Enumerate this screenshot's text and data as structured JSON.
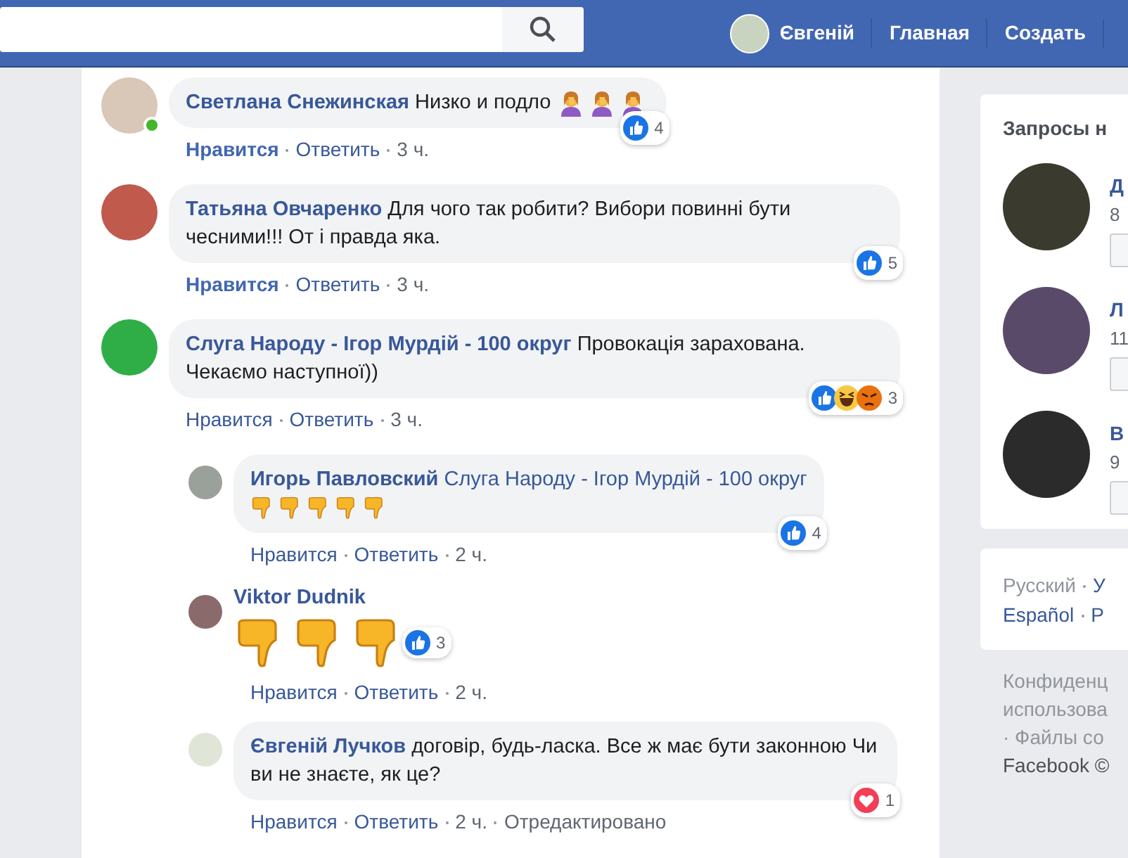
{
  "topbar": {
    "user": "Євгеній",
    "links": [
      "Главная",
      "Создать"
    ]
  },
  "comments": [
    {
      "kind": "text",
      "author": "Светлана Снежинская",
      "text": "Низко и подло",
      "emojis": [
        {
          "kind": "facepalm"
        },
        {
          "kind": "facepalm"
        },
        {
          "kind": "facepalm"
        }
      ],
      "online": true,
      "like": "Нравится",
      "liked": true,
      "reply": "Ответить",
      "time": "3 ч.",
      "reactions": [
        {
          "kind": "like"
        }
      ],
      "reaction_count": "4"
    },
    {
      "kind": "text",
      "author": "Татьяна Овчаренко",
      "text": "Для чого так робити? Вибори повинні бути чесними!!! От і правда яка.",
      "online": false,
      "like": "Нравится",
      "liked": true,
      "reply": "Ответить",
      "time": "3 ч.",
      "reactions": [
        {
          "kind": "like"
        }
      ],
      "reaction_count": "5"
    },
    {
      "kind": "text",
      "author": "Слуга Народу - Ігор Мурдій - 100 округ",
      "text": "Провокація зарахована. Чекаємо наступної))",
      "online": false,
      "like": "Нравится",
      "liked": false,
      "reply": "Ответить",
      "time": "3 ч.",
      "reactions": [
        {
          "kind": "like"
        },
        {
          "kind": "haha"
        },
        {
          "kind": "angry"
        }
      ],
      "reaction_count": "3",
      "replies": [
        {
          "kind": "text",
          "author": "Игорь Павловский",
          "mention": "Слуга Народу - Ігор Мурдій - 100 округ",
          "emojis": [
            {
              "kind": "thumbs_down"
            },
            {
              "kind": "thumbs_down"
            },
            {
              "kind": "thumbs_down"
            },
            {
              "kind": "thumbs_down"
            },
            {
              "kind": "thumbs_down"
            }
          ],
          "like": "Нравится",
          "liked": false,
          "reply": "Ответить",
          "time": "2 ч.",
          "reactions": [
            {
              "kind": "like"
            }
          ],
          "reaction_count": "4"
        },
        {
          "kind": "emoji",
          "author": "Viktor Dudnik",
          "emojis": [
            {
              "kind": "thumbs_down"
            },
            {
              "kind": "thumbs_down"
            },
            {
              "kind": "thumbs_down"
            }
          ],
          "like": "Нравится",
          "liked": false,
          "reply": "Ответить",
          "time": "2 ч.",
          "reactions": [
            {
              "kind": "like"
            }
          ],
          "reaction_count": "3"
        },
        {
          "kind": "text",
          "author": "Євгеній Лучков",
          "text": "договір, будь-ласка. Все ж має бути законною Чи ви не знаєте, як це?",
          "like": "Нравится",
          "liked": false,
          "reply": "Ответить",
          "time": "2 ч.",
          "edited": "Отредактировано",
          "reactions": [
            {
              "kind": "love"
            }
          ],
          "reaction_count": "1"
        }
      ]
    }
  ],
  "sidebar": {
    "requests": {
      "title": "Запросы н",
      "people": [
        {
          "name": "Д",
          "info": "8"
        },
        {
          "name": "Л",
          "info": "11"
        },
        {
          "name": "В",
          "info": "9"
        }
      ]
    },
    "languages": [
      {
        "label": "Русский",
        "selected": true
      },
      {
        "label": "У",
        "selected": false
      },
      {
        "label": "Español",
        "selected": false
      },
      {
        "label": "P",
        "selected": false
      }
    ],
    "footer_lines": [
      "Конфиденц",
      "использова",
      "· Файлы со",
      "Facebook ©"
    ]
  }
}
